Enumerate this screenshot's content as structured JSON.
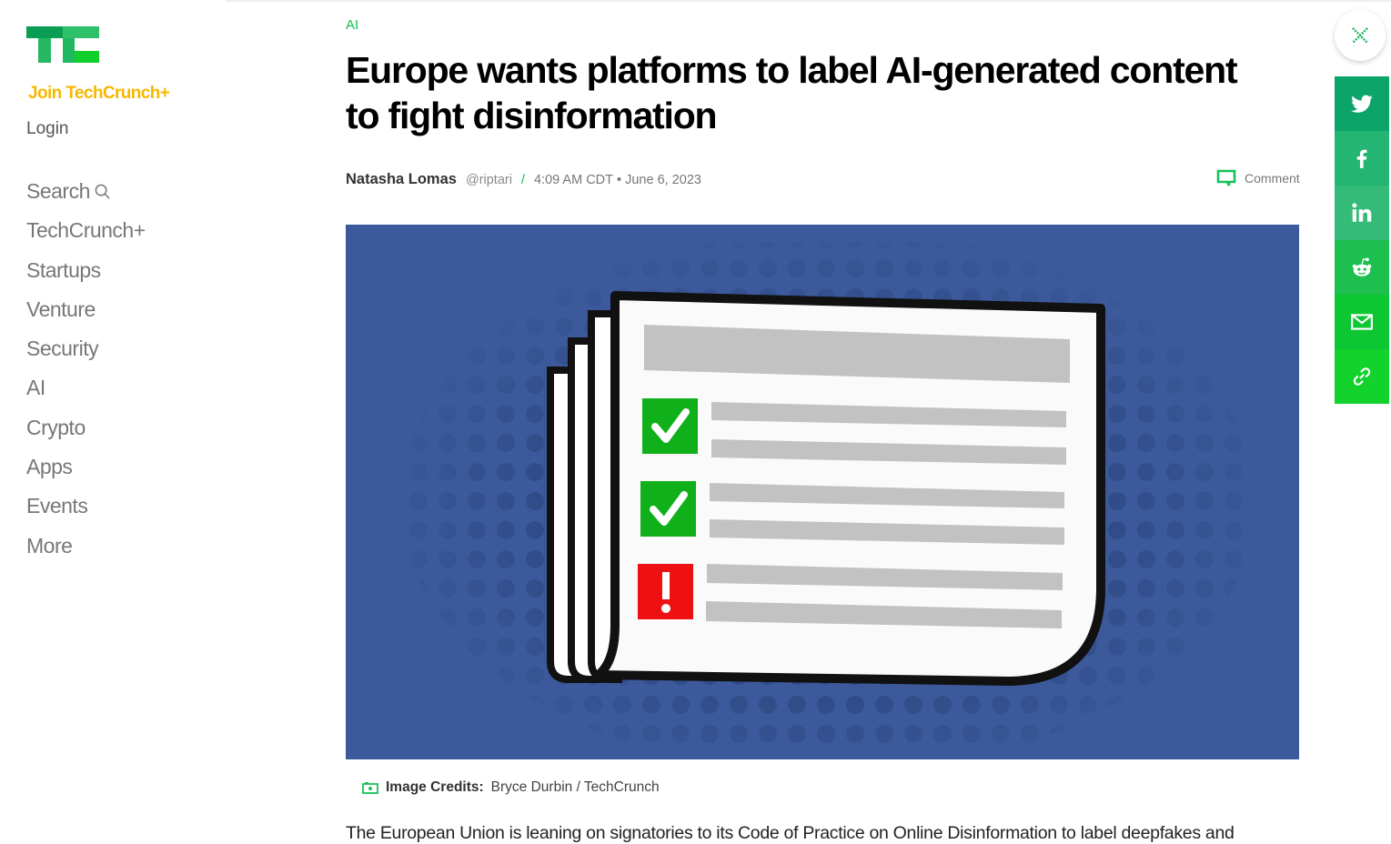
{
  "brand": {
    "logo_icon": "techcrunch-logo",
    "join_label": "Join TechCrunch+",
    "login_label": "Login",
    "colors": {
      "green": "#0fbe4f",
      "gold": "#f5b800"
    }
  },
  "nav": {
    "items": [
      {
        "label": "Search",
        "icon": "search-icon"
      },
      {
        "label": "TechCrunch+"
      },
      {
        "label": "Startups"
      },
      {
        "label": "Venture"
      },
      {
        "label": "Security"
      },
      {
        "label": "AI"
      },
      {
        "label": "Crypto"
      },
      {
        "label": "Apps"
      },
      {
        "label": "Events"
      },
      {
        "label": "More"
      }
    ]
  },
  "article": {
    "category": "AI",
    "title": "Europe wants platforms to label AI-generated content to fight disinformation",
    "author": "Natasha Lomas",
    "handle": "@riptari",
    "separator": "/",
    "time": "4:09 AM CDT",
    "bullet": "•",
    "date": "June 6, 2023",
    "comment_label": "Comment",
    "hero_alt": "Illustration of a newspaper checklist with two green check marks and one red exclamation mark on a blue halftone background",
    "hero_background": "#3c5a9b",
    "credits_label": "Image Credits:",
    "credits_value": "Bryce Durbin / TechCrunch",
    "first_paragraph": "The European Union is leaning on signatories to its Code of Practice on Online Disinformation to label deepfakes and"
  },
  "share": {
    "close_icon": "close-icon",
    "items": [
      {
        "name": "twitter",
        "color": "#0da46a"
      },
      {
        "name": "facebook",
        "color": "#23b571"
      },
      {
        "name": "linkedin",
        "color": "#33bb77"
      },
      {
        "name": "reddit",
        "color": "#1dbf4e"
      },
      {
        "name": "email",
        "color": "#0cc632"
      },
      {
        "name": "copy-link",
        "color": "#12d22c"
      }
    ]
  }
}
